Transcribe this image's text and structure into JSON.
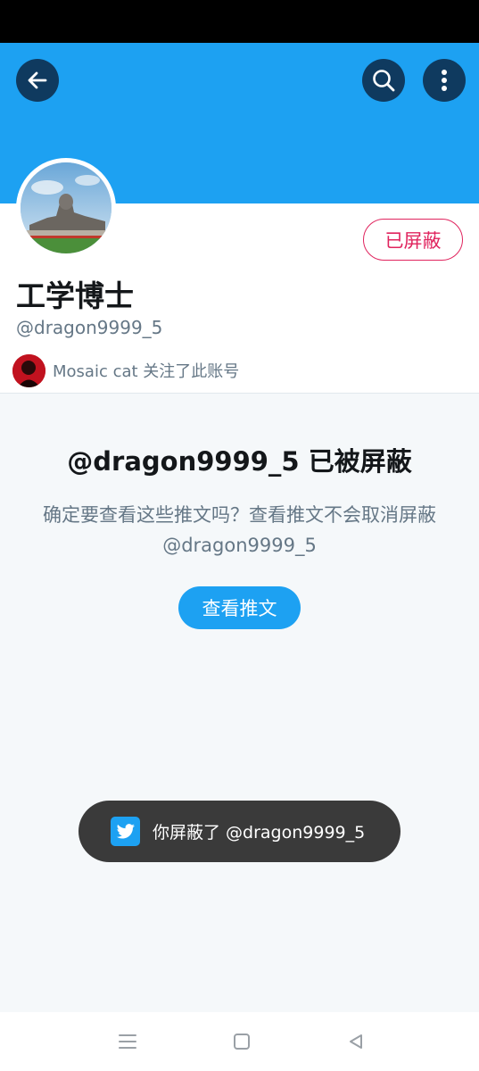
{
  "header": {
    "back_icon": "arrow-left-icon",
    "search_icon": "search-icon",
    "more_icon": "more-vertical-icon",
    "banner_color": "#1da1f2"
  },
  "profile": {
    "display_name": "工学博士",
    "handle": "@dragon9999_5",
    "blocked_button_label": "已屏蔽",
    "followed_by_text": "Mosaic cat 关注了此账号"
  },
  "blocked_notice": {
    "title": "@dragon9999_5 已被屏蔽",
    "description": "确定要查看这些推文吗？查看推文不会取消屏蔽 @dragon9999_5",
    "view_button_label": "查看推文"
  },
  "toast": {
    "icon": "twitter-bird-icon",
    "text": "你屏蔽了 @dragon9999_5"
  },
  "system_nav": {
    "menu_icon": "menu-icon",
    "home_icon": "home-square-icon",
    "back_icon": "back-triangle-icon"
  },
  "colors": {
    "accent": "#1da1f2",
    "blocked_red": "#e0245e",
    "toast_bg": "#3a3a3a"
  }
}
